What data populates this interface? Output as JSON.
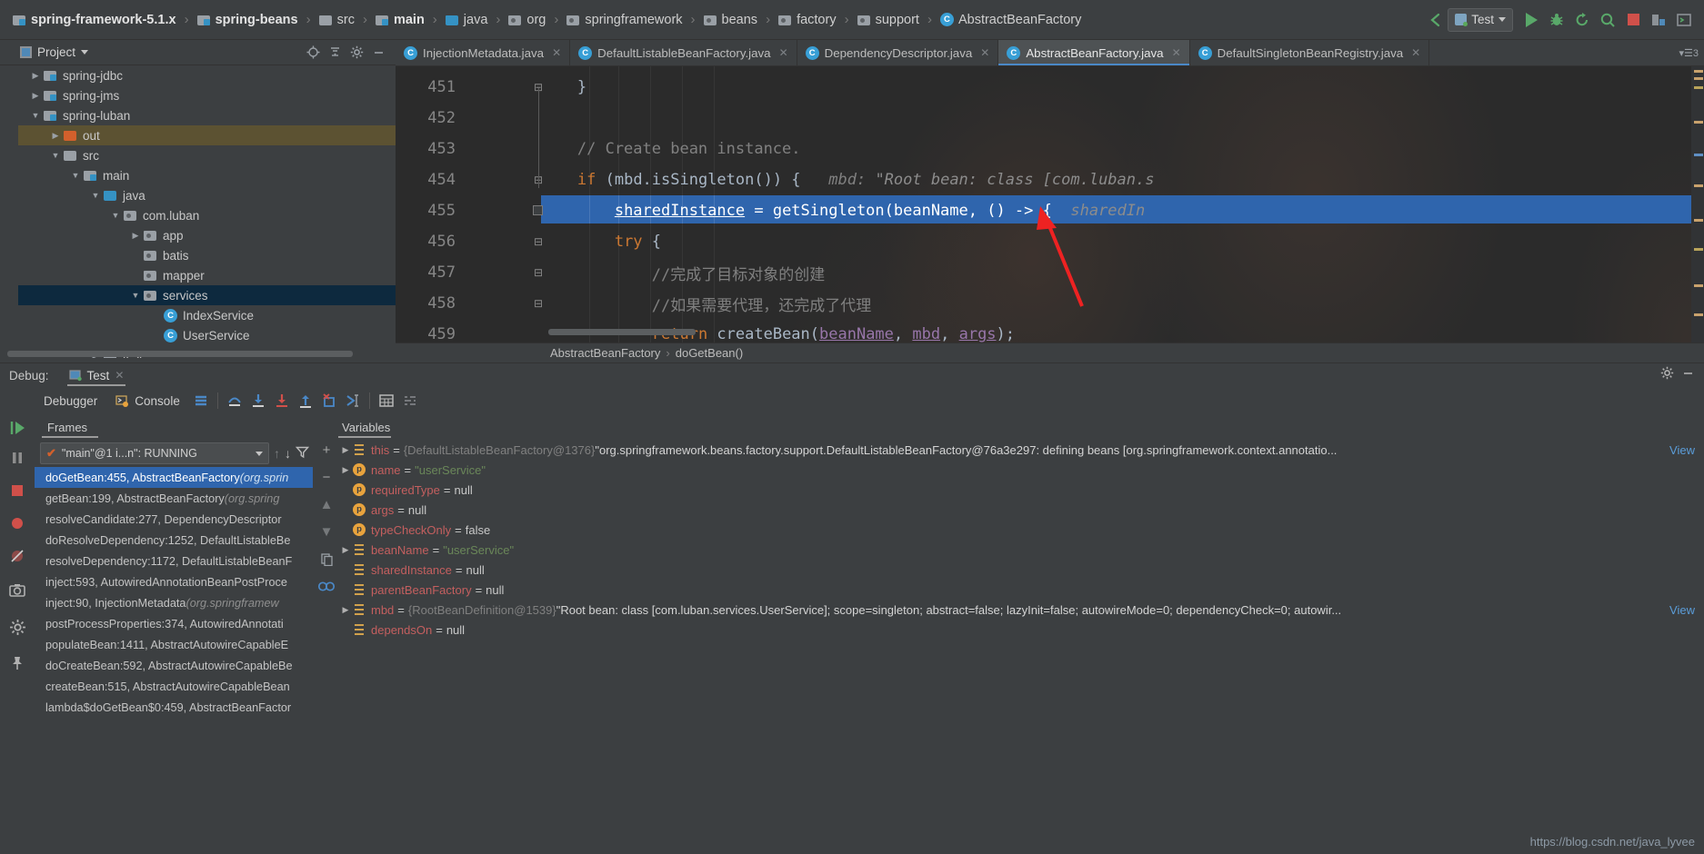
{
  "topbar": {
    "breadcrumbs": [
      {
        "label": "spring-framework-5.1.x",
        "icon": "module-folder-icon",
        "bold": true
      },
      {
        "label": "spring-beans",
        "icon": "module-folder-icon",
        "bold": true
      },
      {
        "label": "src",
        "icon": "folder-icon",
        "bold": false
      },
      {
        "label": "main",
        "icon": "module-folder-icon",
        "bold": true
      },
      {
        "label": "java",
        "icon": "source-folder-icon",
        "bold": false
      },
      {
        "label": "org",
        "icon": "package-icon",
        "bold": false
      },
      {
        "label": "springframework",
        "icon": "package-icon",
        "bold": false
      },
      {
        "label": "beans",
        "icon": "package-icon",
        "bold": false
      },
      {
        "label": "factory",
        "icon": "package-icon",
        "bold": false
      },
      {
        "label": "support",
        "icon": "package-icon",
        "bold": false
      },
      {
        "label": "AbstractBeanFactory",
        "icon": "class-icon",
        "bold": false
      }
    ],
    "run_config": "Test",
    "buttons": [
      "back-icon",
      "run-icon",
      "debug-icon",
      "rerun-icon",
      "attach-icon",
      "stop-icon",
      "coverage-icon",
      "profiler-icon"
    ]
  },
  "project_panel": {
    "title": "Project",
    "header_icons": [
      "locate-icon",
      "collapse-all-icon",
      "settings-gear-icon",
      "minimize-icon"
    ],
    "tree": [
      {
        "label": "spring-jdbc",
        "depth": 1,
        "arrow": "right",
        "icon": "module-folder-icon",
        "state": "normal"
      },
      {
        "label": "spring-jms",
        "depth": 1,
        "arrow": "right",
        "icon": "module-folder-icon",
        "state": "normal"
      },
      {
        "label": "spring-luban",
        "depth": 1,
        "arrow": "down",
        "icon": "module-folder-icon",
        "state": "normal"
      },
      {
        "label": "out",
        "depth": 2,
        "arrow": "right",
        "icon": "excluded-folder-icon",
        "state": "out"
      },
      {
        "label": "src",
        "depth": 2,
        "arrow": "down",
        "icon": "folder-icon",
        "state": "normal"
      },
      {
        "label": "main",
        "depth": 3,
        "arrow": "down",
        "icon": "module-folder-icon",
        "state": "normal"
      },
      {
        "label": "java",
        "depth": 4,
        "arrow": "down",
        "icon": "source-folder-icon",
        "state": "normal"
      },
      {
        "label": "com.luban",
        "depth": 5,
        "arrow": "down",
        "icon": "package-icon",
        "state": "normal"
      },
      {
        "label": "app",
        "depth": 6,
        "arrow": "right",
        "icon": "package-icon",
        "state": "normal"
      },
      {
        "label": "batis",
        "depth": 6,
        "arrow": "none",
        "icon": "package-icon",
        "state": "normal"
      },
      {
        "label": "mapper",
        "depth": 6,
        "arrow": "none",
        "icon": "package-icon",
        "state": "normal"
      },
      {
        "label": "services",
        "depth": 6,
        "arrow": "down",
        "icon": "package-icon",
        "state": "selected"
      },
      {
        "label": "IndexService",
        "depth": 7,
        "arrow": "none",
        "icon": "class-icon",
        "state": "normal"
      },
      {
        "label": "UserService",
        "depth": 7,
        "arrow": "none",
        "icon": "class-icon",
        "state": "normal"
      },
      {
        "label": "test",
        "depth": 4,
        "arrow": "right",
        "icon": "folder-icon",
        "state": "normal"
      }
    ]
  },
  "editor_tabs": [
    {
      "label": "InjectionMetadata.java",
      "active": false
    },
    {
      "label": "DefaultListableBeanFactory.java",
      "active": false
    },
    {
      "label": "DependencyDescriptor.java",
      "active": false
    },
    {
      "label": "AbstractBeanFactory.java",
      "active": true
    },
    {
      "label": "DefaultSingletonBeanRegistry.java",
      "active": false
    }
  ],
  "editor": {
    "lines": [
      {
        "num": "451",
        "segments": [
          {
            "t": "        }",
            "c": "plain"
          }
        ]
      },
      {
        "num": "452",
        "segments": []
      },
      {
        "num": "453",
        "segments": [
          {
            "t": "        // Create bean instance.",
            "c": "cmt"
          }
        ]
      },
      {
        "num": "454",
        "segments": [
          {
            "t": "        ",
            "c": "plain"
          },
          {
            "t": "if",
            "c": "kw"
          },
          {
            "t": " (mbd.isSingleton()) {",
            "c": "plain"
          },
          {
            "t": "   mbd:",
            "c": "hint"
          },
          {
            "t": " \"Root bean: class [com.luban.s",
            "c": "hint-str"
          }
        ]
      },
      {
        "num": "455",
        "highlighted": true,
        "segments": [
          {
            "t": "            ",
            "c": "sel-txt"
          },
          {
            "t": "sharedInstance",
            "c": "sel-und"
          },
          {
            "t": " = getSingleton(beanName, () -> {",
            "c": "sel-txt"
          },
          {
            "t": "  sharedIn",
            "c": "hint-str"
          }
        ]
      },
      {
        "num": "456",
        "segments": [
          {
            "t": "            ",
            "c": "plain"
          },
          {
            "t": "try",
            "c": "kw"
          },
          {
            "t": " {",
            "c": "plain"
          }
        ]
      },
      {
        "num": "457",
        "segments": [
          {
            "t": "                //完成了目标对象的创建",
            "c": "cmt"
          }
        ]
      },
      {
        "num": "458",
        "segments": [
          {
            "t": "                //如果需要代理，还完成了代理",
            "c": "cmt"
          }
        ]
      },
      {
        "num": "459",
        "segments": [
          {
            "t": "                ",
            "c": "plain"
          },
          {
            "t": "return",
            "c": "kw"
          },
          {
            "t": " createBean(",
            "c": "plain"
          },
          {
            "t": "beanName",
            "c": "purple-und"
          },
          {
            "t": ", ",
            "c": "plain"
          },
          {
            "t": "mbd",
            "c": "purple-und"
          },
          {
            "t": ", ",
            "c": "plain"
          },
          {
            "t": "args",
            "c": "purple-und"
          },
          {
            "t": ");",
            "c": "plain"
          }
        ]
      }
    ],
    "breadcrumb": [
      "AbstractBeanFactory",
      "doGetBean()"
    ]
  },
  "debug": {
    "label": "Debug:",
    "session": "Test",
    "tabs": [
      {
        "label": "Debugger",
        "active": true,
        "icon": null
      },
      {
        "label": "Console",
        "active": false,
        "icon": "console-icon"
      }
    ],
    "toolbar_icons": [
      "rerun-icon",
      "mute-breakpoints-icon",
      "show-execution-point-icon",
      "step-over-icon",
      "step-into-icon",
      "force-step-into-icon",
      "step-out-icon",
      "drop-frame-icon",
      "run-to-cursor-icon",
      "evaluate-expression-icon",
      "layout-icon"
    ],
    "left_strip_icons": [
      "resume-icon",
      "pause-icon",
      "stop-icon",
      "view-breakpoints-icon",
      "mute-breakpoints-icon",
      "camera-icon",
      "settings-icon",
      "pin-icon"
    ],
    "frames": {
      "tab_label": "Frames",
      "thread": "\"main\"@1 i...n\": RUNNING",
      "items": [
        {
          "method": "doGetBean:455, AbstractBeanFactory",
          "pkg": "(org.sprin",
          "selected": true
        },
        {
          "method": "getBean:199, AbstractBeanFactory",
          "pkg": "(org.spring",
          "selected": false
        },
        {
          "method": "resolveCandidate:277, DependencyDescriptor",
          "pkg": "",
          "selected": false
        },
        {
          "method": "doResolveDependency:1252, DefaultListableBe",
          "pkg": "",
          "selected": false
        },
        {
          "method": "resolveDependency:1172, DefaultListableBeanF",
          "pkg": "",
          "selected": false
        },
        {
          "method": "inject:593, AutowiredAnnotationBeanPostProce",
          "pkg": "",
          "selected": false
        },
        {
          "method": "inject:90, InjectionMetadata",
          "pkg": "(org.springframew",
          "selected": false
        },
        {
          "method": "postProcessProperties:374, AutowiredAnnotati",
          "pkg": "",
          "selected": false
        },
        {
          "method": "populateBean:1411, AbstractAutowireCapableE",
          "pkg": "",
          "selected": false
        },
        {
          "method": "doCreateBean:592, AbstractAutowireCapableBe",
          "pkg": "",
          "selected": false
        },
        {
          "method": "createBean:515, AbstractAutowireCapableBean",
          "pkg": "",
          "selected": false
        },
        {
          "method": "lambda$doGetBean$0:459, AbstractBeanFactor",
          "pkg": "",
          "selected": false
        }
      ]
    },
    "variables": {
      "tab_label": "Variables",
      "items": [
        {
          "arrow": "right",
          "icon": "field-icon",
          "name": "this",
          "value_id": "{DefaultListableBeanFactory@1376}",
          "value_text": "\"org.springframework.beans.factory.support.DefaultListableBeanFactory@76a3e297: defining beans [org.springframework.context.annotatio...",
          "value_type": "object",
          "view_link": "View"
        },
        {
          "arrow": "right",
          "icon": "param-icon",
          "name": "name",
          "value_id": "",
          "value_text": "\"userService\"",
          "value_type": "string",
          "view_link": ""
        },
        {
          "arrow": "none",
          "icon": "param-icon",
          "name": "requiredType",
          "value_id": "",
          "value_text": "null",
          "value_type": "null",
          "view_link": ""
        },
        {
          "arrow": "none",
          "icon": "param-icon",
          "name": "args",
          "value_id": "",
          "value_text": "null",
          "value_type": "null",
          "view_link": ""
        },
        {
          "arrow": "none",
          "icon": "param-icon",
          "name": "typeCheckOnly",
          "value_id": "",
          "value_text": "false",
          "value_type": "plain",
          "view_link": ""
        },
        {
          "arrow": "right",
          "icon": "field-icon",
          "name": "beanName",
          "value_id": "",
          "value_text": "\"userService\"",
          "value_type": "string",
          "view_link": ""
        },
        {
          "arrow": "none",
          "icon": "field-icon",
          "name": "sharedInstance",
          "value_id": "",
          "value_text": "null",
          "value_type": "null",
          "view_link": ""
        },
        {
          "arrow": "none",
          "icon": "field-icon",
          "name": "parentBeanFactory",
          "value_id": "",
          "value_text": "null",
          "value_type": "null",
          "view_link": ""
        },
        {
          "arrow": "right",
          "icon": "field-icon",
          "name": "mbd",
          "value_id": "{RootBeanDefinition@1539}",
          "value_text": "\"Root bean: class [com.luban.services.UserService]; scope=singleton; abstract=false; lazyInit=false; autowireMode=0; dependencyCheck=0; autowir...",
          "value_type": "object",
          "view_link": "View"
        },
        {
          "arrow": "none",
          "icon": "field-icon",
          "name": "dependsOn",
          "value_id": "",
          "value_text": "null",
          "value_type": "null",
          "view_link": ""
        }
      ]
    }
  },
  "watermark": "https://blog.csdn.net/java_lyvee",
  "colors": {
    "accent_blue": "#2f65ad",
    "selection_tree": "#0d293e",
    "out_folder": "#5c5232",
    "keyword_orange": "#cc7832",
    "string_green": "#6a8759",
    "editor_bg": "#2b2b2b",
    "panel_bg": "#3c3f41",
    "annotation_red": "#ee2222"
  }
}
